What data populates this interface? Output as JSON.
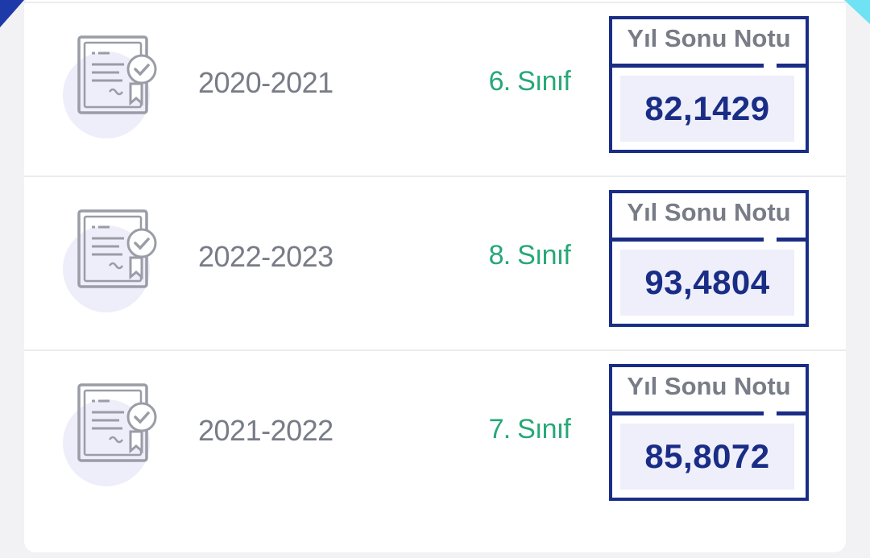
{
  "score_label": "Yıl Sonu Notu",
  "icon": "certificate-icon",
  "colors": {
    "accent": "#1a2d86",
    "grade": "#27a878",
    "muted": "#777c86"
  },
  "records": [
    {
      "year": "2020-2021",
      "grade": "6. Sınıf",
      "score": "82,1429"
    },
    {
      "year": "2022-2023",
      "grade": "8. Sınıf",
      "score": "93,4804"
    },
    {
      "year": "2021-2022",
      "grade": "7. Sınıf",
      "score": "85,8072"
    }
  ]
}
